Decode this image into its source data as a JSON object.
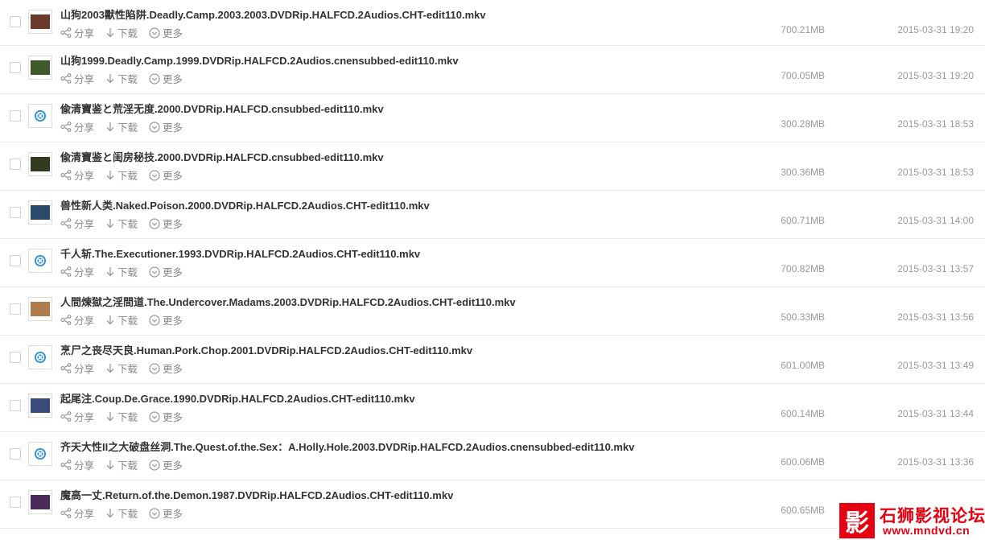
{
  "actions": {
    "share": "分享",
    "download": "下载",
    "more": "更多"
  },
  "files": [
    {
      "name": "山狗2003獸性陷阱.Deadly.Camp.2003.2003.DVDRip.HALFCD.2Audios.CHT-edit110.mkv",
      "size": "700.21MB",
      "date": "2015-03-31 19:20",
      "thumb": "image",
      "thumb_color": "#6a3a2a"
    },
    {
      "name": "山狗1999.Deadly.Camp.1999.DVDRip.HALFCD.2Audios.cnensubbed-edit110.mkv",
      "size": "700.05MB",
      "date": "2015-03-31 19:20",
      "thumb": "image",
      "thumb_color": "#3f5a2a"
    },
    {
      "name": "偸清寶鉴と荒淫无度.2000.DVDRip.HALFCD.cnsubbed-edit110.mkv",
      "size": "300.28MB",
      "date": "2015-03-31 18:53",
      "thumb": "video",
      "thumb_color": "#2a8ee0"
    },
    {
      "name": "偸清寶鉴と闺房秘技.2000.DVDRip.HALFCD.cnsubbed-edit110.mkv",
      "size": "300.36MB",
      "date": "2015-03-31 18:53",
      "thumb": "image",
      "thumb_color": "#2f3a1f"
    },
    {
      "name": "兽性新人类.Naked.Poison.2000.DVDRip.HALFCD.2Audios.CHT-edit110.mkv",
      "size": "600.71MB",
      "date": "2015-03-31 14:00",
      "thumb": "image",
      "thumb_color": "#2a4a6a"
    },
    {
      "name": "千人斩.The.Executioner.1993.DVDRip.HALFCD.2Audios.CHT-edit110.mkv",
      "size": "700.82MB",
      "date": "2015-03-31 13:57",
      "thumb": "video",
      "thumb_color": "#2a8ee0"
    },
    {
      "name": "人間煉獄之淫間道.The.Undercover.Madams.2003.DVDRip.HALFCD.2Audios.CHT-edit110.mkv",
      "size": "500.33MB",
      "date": "2015-03-31 13:56",
      "thumb": "image",
      "thumb_color": "#b07a4a"
    },
    {
      "name": "烹尸之丧尽天良.Human.Pork.Chop.2001.DVDRip.HALFCD.2Audios.CHT-edit110.mkv",
      "size": "601.00MB",
      "date": "2015-03-31 13:49",
      "thumb": "video",
      "thumb_color": "#2a8ee0"
    },
    {
      "name": "起尾注.Coup.De.Grace.1990.DVDRip.HALFCD.2Audios.CHT-edit110.mkv",
      "size": "600.14MB",
      "date": "2015-03-31 13:44",
      "thumb": "image",
      "thumb_color": "#3a4a7a"
    },
    {
      "name": "齐天大性II之大破盘丝洞.The.Quest.of.the.Sex：A.Holly.Hole.2003.DVDRip.HALFCD.2Audios.cnensubbed-edit110.mkv",
      "size": "600.06MB",
      "date": "2015-03-31 13:36",
      "thumb": "video",
      "thumb_color": "#2a8ee0"
    },
    {
      "name": "魔高一丈.Return.of.the.Demon.1987.DVDRip.HALFCD.2Audios.CHT-edit110.mkv",
      "size": "600.65MB",
      "date": "",
      "thumb": "image",
      "thumb_color": "#4a2a5a"
    }
  ],
  "watermark": {
    "logo_char": "影",
    "name": "石狮影视论坛",
    "url": "www.mndvd.cn",
    "color": "#e60012"
  }
}
